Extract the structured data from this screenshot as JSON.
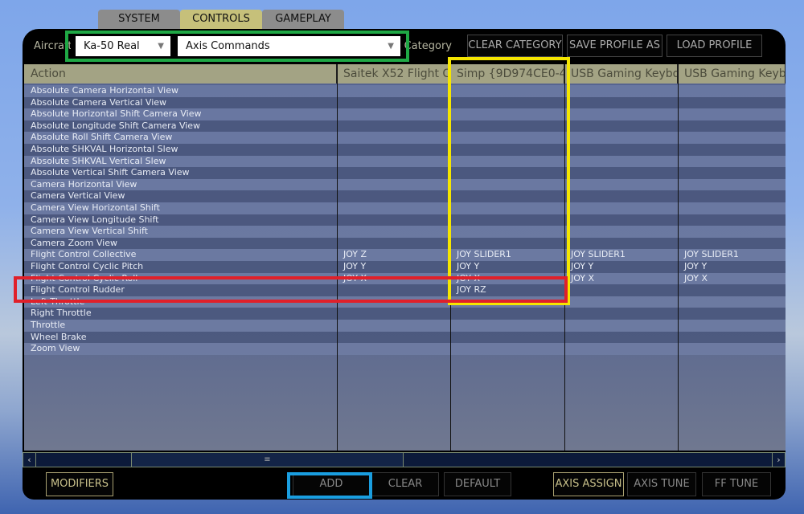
{
  "tabs": [
    "SYSTEM",
    "CONTROLS",
    "GAMEPLAY"
  ],
  "toolbar": {
    "aircraft_label": "Aircraft",
    "aircraft_value": "Ka-50 Real",
    "category_value": "Axis Commands",
    "category_label": "Category",
    "clear_category": "CLEAR CATEGORY",
    "save_profile": "SAVE PROFILE AS",
    "load_profile": "LOAD PROFILE"
  },
  "columns": [
    "Action",
    "Saitek X52 Flight C",
    "Simp {9D974CE0-4",
    "USB Gaming Keybo",
    "USB Gaming Keyb"
  ],
  "rows": [
    {
      "action": "Absolute Camera Horizontal View",
      "c": [
        "",
        "",
        "",
        ""
      ]
    },
    {
      "action": "Absolute Camera Vertical View",
      "c": [
        "",
        "",
        "",
        ""
      ]
    },
    {
      "action": "Absolute Horizontal Shift Camera View",
      "c": [
        "",
        "",
        "",
        ""
      ]
    },
    {
      "action": "Absolute Longitude Shift Camera View",
      "c": [
        "",
        "",
        "",
        ""
      ]
    },
    {
      "action": "Absolute Roll Shift Camera View",
      "c": [
        "",
        "",
        "",
        ""
      ]
    },
    {
      "action": "Absolute SHKVAL Horizontal Slew",
      "c": [
        "",
        "",
        "",
        ""
      ]
    },
    {
      "action": "Absolute SHKVAL Vertical Slew",
      "c": [
        "",
        "",
        "",
        ""
      ]
    },
    {
      "action": "Absolute Vertical Shift Camera View",
      "c": [
        "",
        "",
        "",
        ""
      ]
    },
    {
      "action": "Camera Horizontal View",
      "c": [
        "",
        "",
        "",
        ""
      ]
    },
    {
      "action": "Camera Vertical View",
      "c": [
        "",
        "",
        "",
        ""
      ]
    },
    {
      "action": "Camera View Horizontal Shift",
      "c": [
        "",
        "",
        "",
        ""
      ]
    },
    {
      "action": "Camera View Longitude Shift",
      "c": [
        "",
        "",
        "",
        ""
      ]
    },
    {
      "action": "Camera View Vertical Shift",
      "c": [
        "",
        "",
        "",
        ""
      ]
    },
    {
      "action": "Camera Zoom View",
      "c": [
        "",
        "",
        "",
        ""
      ]
    },
    {
      "action": "Flight Control Collective",
      "c": [
        "JOY Z",
        "JOY SLIDER1",
        "JOY SLIDER1",
        "JOY SLIDER1"
      ]
    },
    {
      "action": "Flight Control Cyclic Pitch",
      "c": [
        "JOY Y",
        "JOY Y",
        "JOY Y",
        "JOY Y"
      ]
    },
    {
      "action": "Flight Control Cyclic Roll",
      "c": [
        "JOY X",
        "JOY X",
        "JOY X",
        "JOY X"
      ]
    },
    {
      "action": "Flight Control Rudder",
      "c": [
        "",
        "JOY RZ",
        "",
        ""
      ]
    },
    {
      "action": "Left Throttle",
      "c": [
        "",
        "",
        "",
        ""
      ]
    },
    {
      "action": "Right Throttle",
      "c": [
        "",
        "",
        "",
        ""
      ]
    },
    {
      "action": "Throttle",
      "c": [
        "",
        "",
        "",
        ""
      ]
    },
    {
      "action": "Wheel Brake",
      "c": [
        "",
        "",
        "",
        ""
      ]
    },
    {
      "action": "Zoom View",
      "c": [
        "",
        "",
        "",
        ""
      ]
    }
  ],
  "scroll_grip": "≡",
  "bottom": {
    "modifiers": "MODIFIERS",
    "add": "ADD",
    "clear": "CLEAR",
    "default": "DEFAULT",
    "axis_assign": "AXIS ASSIGN",
    "axis_tune": "AXIS TUNE",
    "ff_tune": "FF TUNE"
  },
  "annotation_colors": {
    "green": "#1fa845",
    "yellow": "#f5e600",
    "red": "#e0202a",
    "blue": "#1a9ee0"
  }
}
